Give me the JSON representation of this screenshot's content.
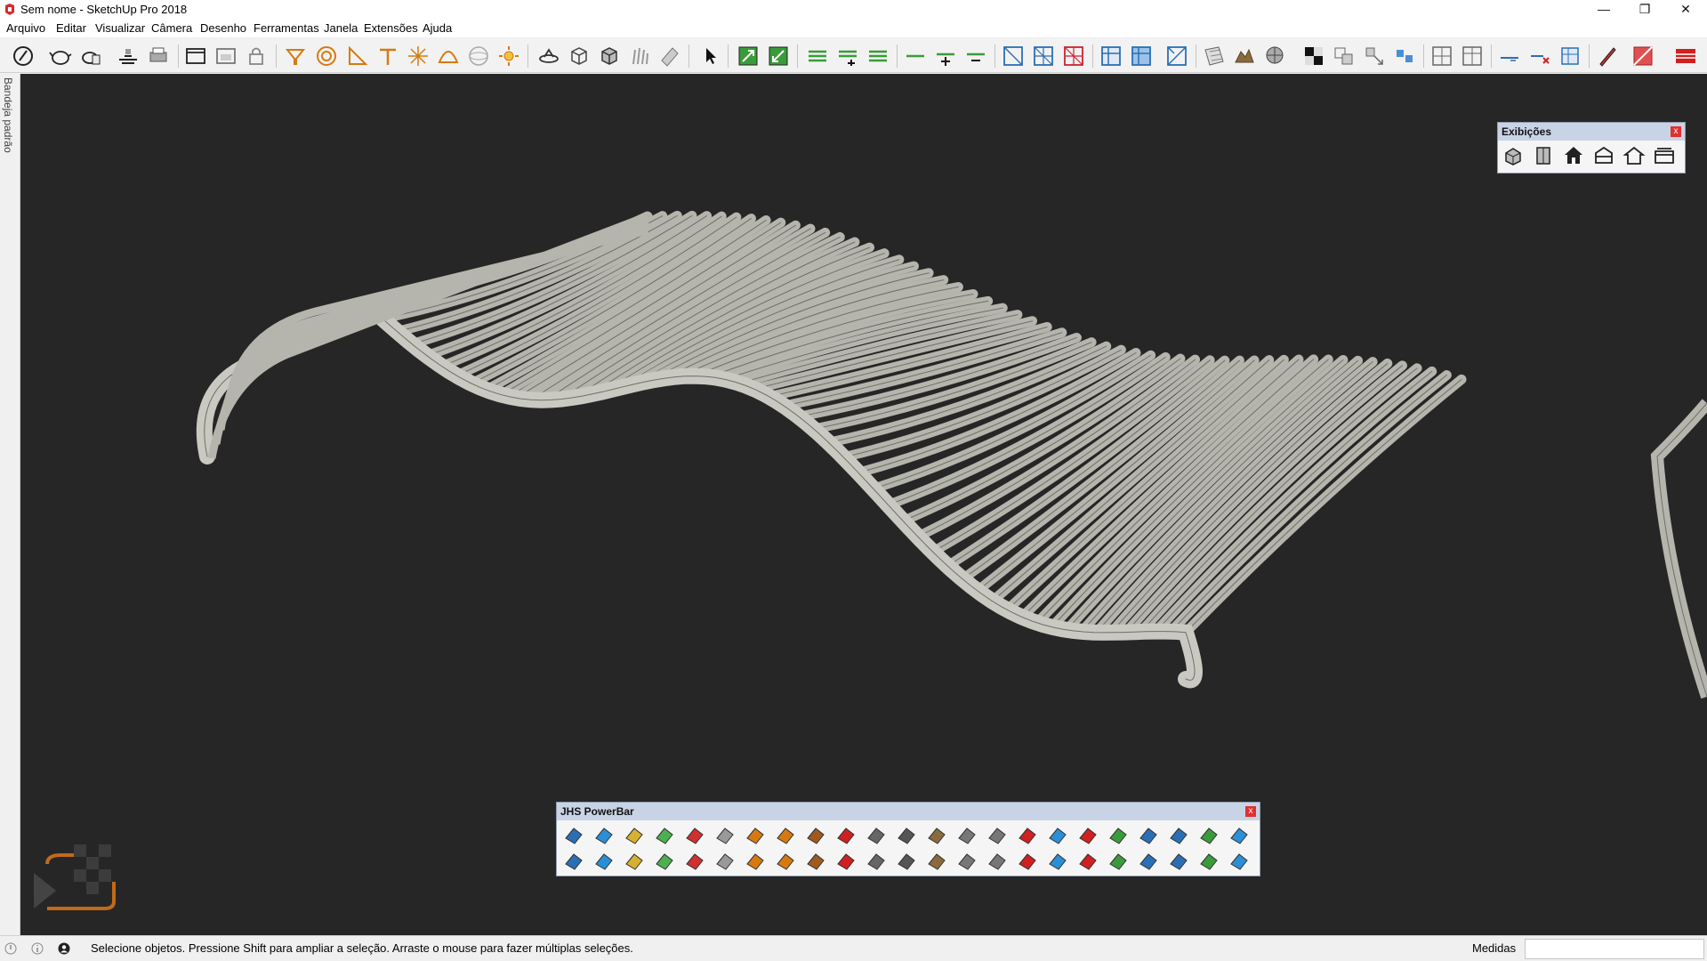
{
  "window": {
    "title": "Sem nome - SketchUp Pro 2018",
    "controls": [
      "minimize-icon",
      "restore-icon",
      "close-icon"
    ]
  },
  "menu": [
    "Arquivo",
    "Editar",
    "Visualizar",
    "Câmera",
    "Desenho",
    "Ferramentas",
    "Janela",
    "Extensões",
    "Ajuda"
  ],
  "toolbar": {
    "icons": [
      "sketchup-logo-icon",
      "teapot-icon",
      "teapot-hand-icon",
      "section-plane-icon",
      "print-icon",
      "window-icon",
      "window-tab-icon",
      "lock-icon",
      "paint-bucket-icon",
      "circle-icon",
      "protractor-icon",
      "text-pin-icon",
      "axes-icon",
      "arc-shell-icon",
      "sphere-icon",
      "sun-icon",
      "camera-orbit-icon",
      "box-icon",
      "box-shaded-icon",
      "grass-icon",
      "pencil-ruler-icon",
      "select-arrow-icon",
      "scale-up-icon",
      "scale-down-icon",
      "lines-icon",
      "lines-plus-icon",
      "lines-minus-icon",
      "line-icon",
      "line-plus-icon",
      "line-minus-icon",
      "grid-1-icon",
      "grid-2-icon",
      "grid-3-icon",
      "table-1-icon",
      "table-2-icon",
      "table-3-icon",
      "texture-icon",
      "terrain-icon",
      "sphere-mesh-icon",
      "checker-icon",
      "component-1-icon",
      "component-2-icon",
      "component-3-icon",
      "panel-1-icon",
      "panel-2-icon",
      "dimension-icon",
      "dimension-remove-icon",
      "layout-icon",
      "pen-icon",
      "section-red-icon",
      "red-ribbon-icon"
    ]
  },
  "tray": {
    "label": "Bandeja padrão"
  },
  "views_palette": {
    "title": "Exibições",
    "close": "x",
    "icons": [
      "iso-view-icon",
      "front-view-icon",
      "home-view-icon",
      "right-view-icon",
      "back-view-icon",
      "left-view-icon"
    ]
  },
  "powerbar": {
    "title": "JHS PowerBar",
    "close": "x",
    "row1": [
      "face-blue-red-icon",
      "face-blue-icon",
      "face-yellow-icon",
      "face-green-icon",
      "face-red-icon",
      "face-outline-icon",
      "rotate-orange-icon",
      "arch-icon",
      "swirl-icon",
      "square-red-icon",
      "table-icon",
      "flag-icon",
      "box-brown-icon",
      "connector-icon",
      "curve-tool-icon",
      "points-red-icon",
      "points-blue-icon",
      "cross-red-icon",
      "cross-green-icon",
      "cross-blue-icon",
      "grid-dots-icon",
      "cone-green-icon",
      "cone-blue-icon"
    ],
    "row2": [
      "triangle-icon",
      "hook-icon",
      "hook-2-icon",
      "ring-arrows-icon",
      "star-move-icon",
      "cylinder-icon",
      "undo-red-icon",
      "puzzle-green-icon",
      "transform-icon",
      "cubes-red-icon",
      "cubes-2-icon",
      "gem-icon",
      "components-icon",
      "mesh-1-icon",
      "mesh-2-icon",
      "mesh-3-icon",
      "mesh-4-icon",
      "grid-orange-icon",
      "grid-orange-2-icon",
      "grid-orange-3-icon",
      "close-points-icon",
      "curve-dots-icon",
      "panel-grid-icon"
    ]
  },
  "status": {
    "message": "Selecione objetos. Pressione Shift para ampliar a seleção. Arraste o mouse para fazer múltiplas seleções.",
    "measure_label": "Medidas",
    "measure_value": ""
  },
  "colors": {
    "viewport_bg": "#262626",
    "slat": "#b5b5ad",
    "slat_edge": "#6f6f68",
    "palette_header": "#c8d4e6"
  }
}
